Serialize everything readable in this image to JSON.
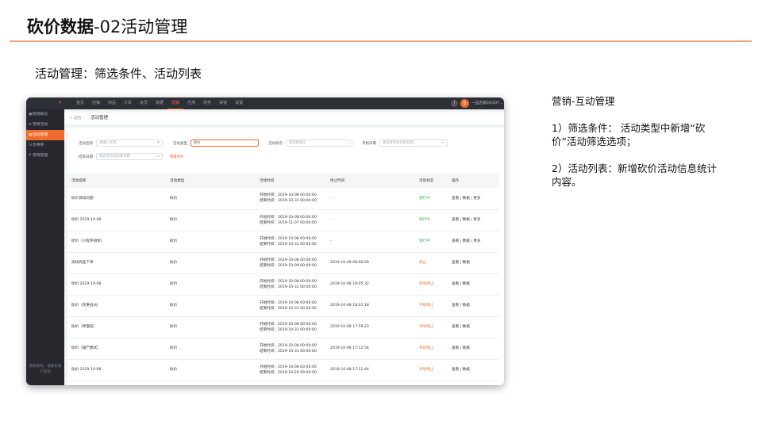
{
  "slide": {
    "title_bold": "砍价数据",
    "title_rest": "-02活动管理",
    "subtitle": "活动管理：筛选条件、活动列表",
    "notes": [
      "营销-互动管理",
      "1）筛选条件： 活动类型中新增“砍价”活动筛选选项；",
      "2）活动列表：新增砍价活动信息统计内容。"
    ]
  },
  "app": {
    "logo": "✕",
    "top_nav": [
      "首页",
      "店铺",
      "商品",
      "订单",
      "会员",
      "数据",
      "营销",
      "应用",
      "财务",
      "渠道",
      "设置"
    ],
    "active_top_nav": "营销",
    "bell": "!",
    "avatar": "b",
    "user": "一些店铺QQQQY ⌄",
    "sidebar": [
      {
        "icon": "▣",
        "label": "营销概况"
      },
      {
        "icon": "⟳",
        "label": "营销活动"
      },
      {
        "icon": "▤",
        "label": "活动管理"
      },
      {
        "icon": "☷",
        "label": "优惠券"
      },
      {
        "icon": "⚲",
        "label": "营销管理"
      }
    ],
    "active_sidebar": "活动管理",
    "sidebar_footer": "需要帮助，请联系我们电话",
    "back": "< 返回",
    "breadcrumb": "活动管理",
    "filters": {
      "name_label": "活动名称",
      "name_placeholder": "请输入名称",
      "name_icon": "⚲",
      "type_label": "活动类型",
      "type_value": "砍价",
      "type_arrow": "⌄",
      "status_label": "活动状态",
      "status_placeholder": "请选择状态",
      "status_arrow": "⌄",
      "start_label": "开始日期",
      "start_placeholder": "请选择活动开始日期",
      "end_label": "结束日期",
      "end_placeholder": "请选择活动结束日期",
      "calendar_icon": "▭",
      "reset": "重置条件"
    },
    "table": {
      "headers": [
        "活动名称",
        "活动类型",
        "活动时间",
        "停止时间",
        "活动状态",
        "操作"
      ],
      "rows": [
        {
          "name": "砍价测试问题",
          "type": "砍价",
          "start": "开始时间：2019-10-08 00:00:00",
          "end": "结束时间：2019-10-31 00:00:00",
          "stop": "-",
          "status": "进行中",
          "status_color": "#3fb34f",
          "ops": "查看 | 数据 | 更多"
        },
        {
          "name": "砍价 2019-10-08",
          "type": "砍价",
          "start": "开始时间：2019-10-08 00:00:00",
          "end": "结束时间：2019-11-07 00:00:00",
          "stop": "-",
          "status": "进行中",
          "status_color": "#3fb34f",
          "ops": "查看 | 数据 | 更多"
        },
        {
          "name": "砍价（小程序进本）",
          "type": "砍价",
          "start": "开始时间：2019-10-08 00:00:00",
          "end": "结束时间：2019-10-31 00:00:00",
          "stop": "-",
          "status": "进行中",
          "status_color": "#3fb34f",
          "ops": "查看 | 数据 | 更多"
        },
        {
          "name": "测试商品下单",
          "type": "砍价",
          "start": "开始时间：2019-10-08 00:00:00",
          "end": "结束时间：2019-10-09 00:00:00",
          "stop": "2019-10-09 00:00:00",
          "status": "停止",
          "status_color": "#f06b2d",
          "ops": "查看 | 数据"
        },
        {
          "name": "砍价 2019-10-08",
          "type": "砍价",
          "start": "开始时间：2019-10-08 00:00:00",
          "end": "结束时间：2019-10-31 00:00:00",
          "stop": "2019-10-08 19:05:32",
          "status": "手动停止",
          "status_color": "#f06b2d",
          "ops": "查看 | 数据"
        },
        {
          "name": "砍价（优惠会员）",
          "type": "砍价",
          "start": "开始时间：2019-10-08 00:00:00",
          "end": "结束时间：2019-10-31 00:00:00",
          "stop": "2019-10-08 18:01:18",
          "status": "手动停止",
          "status_color": "#f06b2d",
          "ops": "查看 | 数据"
        },
        {
          "name": "砍价（界面前）",
          "type": "砍价",
          "start": "开始时间：2019-10-08 00:00:00",
          "end": "结束时间：2019-10-31 00:00:00",
          "stop": "2019-10-08 17:59:23",
          "status": "手动停止",
          "status_color": "#f06b2d",
          "ops": "查看 | 数据"
        },
        {
          "name": "砍价（僵尸模式）",
          "type": "砍价",
          "start": "开始时间：2019-10-08 00:00:00",
          "end": "结束时间：2019-10-31 00:00:00",
          "stop": "2019-10-08 17:12:54",
          "status": "手动停止",
          "status_color": "#f06b2d",
          "ops": "查看 | 数据"
        },
        {
          "name": "砍价 2019-10-08",
          "type": "砍价",
          "start": "开始时间：2019-10-08 00:00:00",
          "end": "结束时间：2019-10-29 00:00:00",
          "stop": "2019-10-08 17:12:44",
          "status": "手动停止",
          "status_color": "#f06b2d",
          "ops": "查看 | 数据"
        }
      ]
    }
  },
  "colors": {
    "accent": "#f06b2d",
    "title_rule": "#f0a37f",
    "topbar": "#2d2f36",
    "sidebar": "#26282e",
    "status_running": "#3fb34f"
  }
}
